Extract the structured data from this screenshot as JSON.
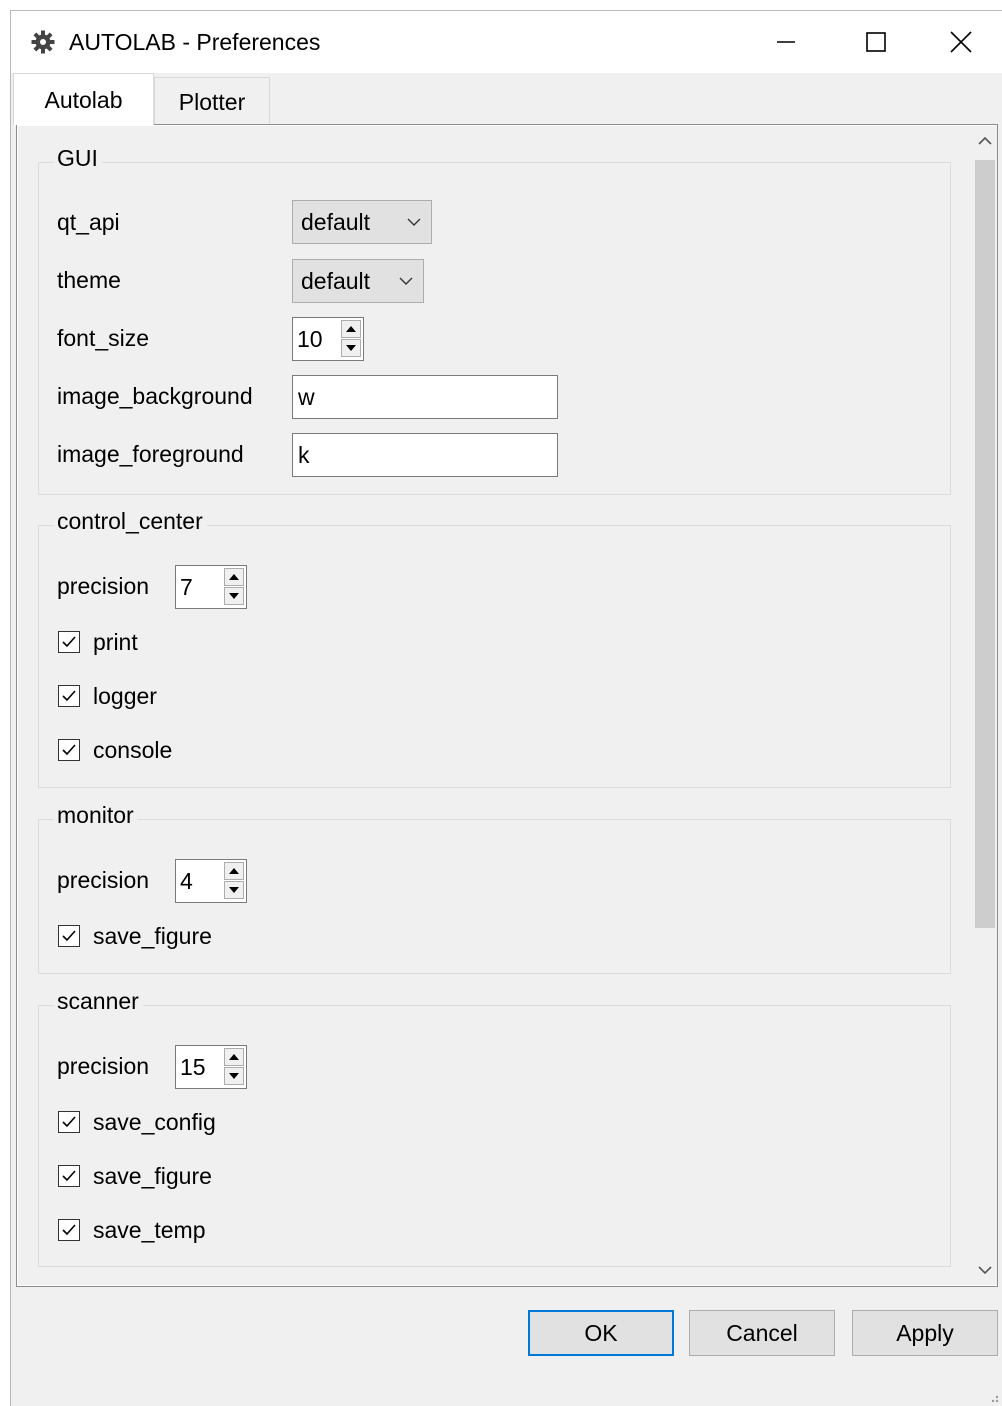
{
  "window": {
    "title": "AUTOLAB - Preferences",
    "icon": "gear-icon"
  },
  "window_controls": {
    "minimize": "minimize-icon",
    "maximize": "maximize-icon",
    "close": "close-icon"
  },
  "tabs": [
    {
      "label": "Autolab",
      "active": true
    },
    {
      "label": "Plotter",
      "active": false
    }
  ],
  "gui": {
    "title": "GUI",
    "qt_api": {
      "label": "qt_api",
      "value": "default"
    },
    "theme": {
      "label": "theme",
      "value": "default"
    },
    "font_size": {
      "label": "font_size",
      "value": "10"
    },
    "image_background": {
      "label": "image_background",
      "value": "w"
    },
    "image_foreground": {
      "label": "image_foreground",
      "value": "k"
    }
  },
  "control_center": {
    "title": "control_center",
    "precision": {
      "label": "precision",
      "value": "7"
    },
    "print": {
      "label": "print",
      "checked": true
    },
    "logger": {
      "label": "logger",
      "checked": true
    },
    "console": {
      "label": "console",
      "checked": true
    }
  },
  "monitor": {
    "title": "monitor",
    "precision": {
      "label": "precision",
      "value": "4"
    },
    "save_figure": {
      "label": "save_figure",
      "checked": true
    }
  },
  "scanner": {
    "title": "scanner",
    "precision": {
      "label": "precision",
      "value": "15"
    },
    "save_config": {
      "label": "save_config",
      "checked": true
    },
    "save_figure": {
      "label": "save_figure",
      "checked": true
    },
    "save_temp": {
      "label": "save_temp",
      "checked": true
    }
  },
  "buttons": {
    "ok": "OK",
    "cancel": "Cancel",
    "apply": "Apply"
  },
  "colors": {
    "accent": "#0078d7",
    "window_bg": "#f0f0f0",
    "button_bg": "#e1e1e1"
  }
}
